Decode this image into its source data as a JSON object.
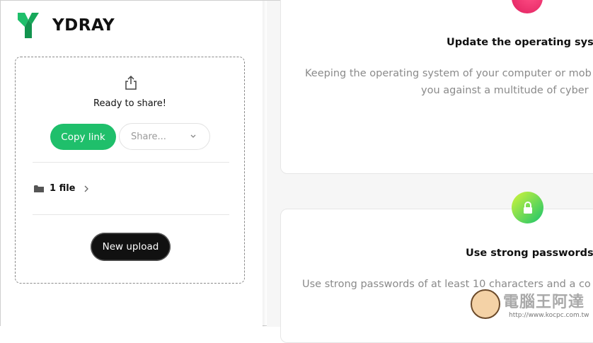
{
  "brand": {
    "name": "YDRAY",
    "logo_color": "#1fbf6b"
  },
  "share_panel": {
    "status": "Ready to share!",
    "copy_link_label": "Copy link",
    "share_placeholder": "Share...",
    "files_label": "1 file",
    "new_upload_label": "New upload"
  },
  "tips": [
    {
      "title": "Update the operating syste",
      "body_line1": "Keeping the operating system of your computer or mob",
      "body_line2": "you against a multitude of cyber",
      "icon": "alert-icon",
      "icon_color": "#e8306d"
    },
    {
      "title": "Use strong passwords",
      "body_line1": "Use strong passwords of at least 10 characters and a co",
      "icon": "lock-icon",
      "icon_color": "#3ccf5a"
    }
  ],
  "watermark": {
    "text": "電腦王阿達",
    "url": "http://www.kocpc.com.tw"
  },
  "colors": {
    "accent": "#1fbf6b",
    "dark_button": "#111111"
  }
}
